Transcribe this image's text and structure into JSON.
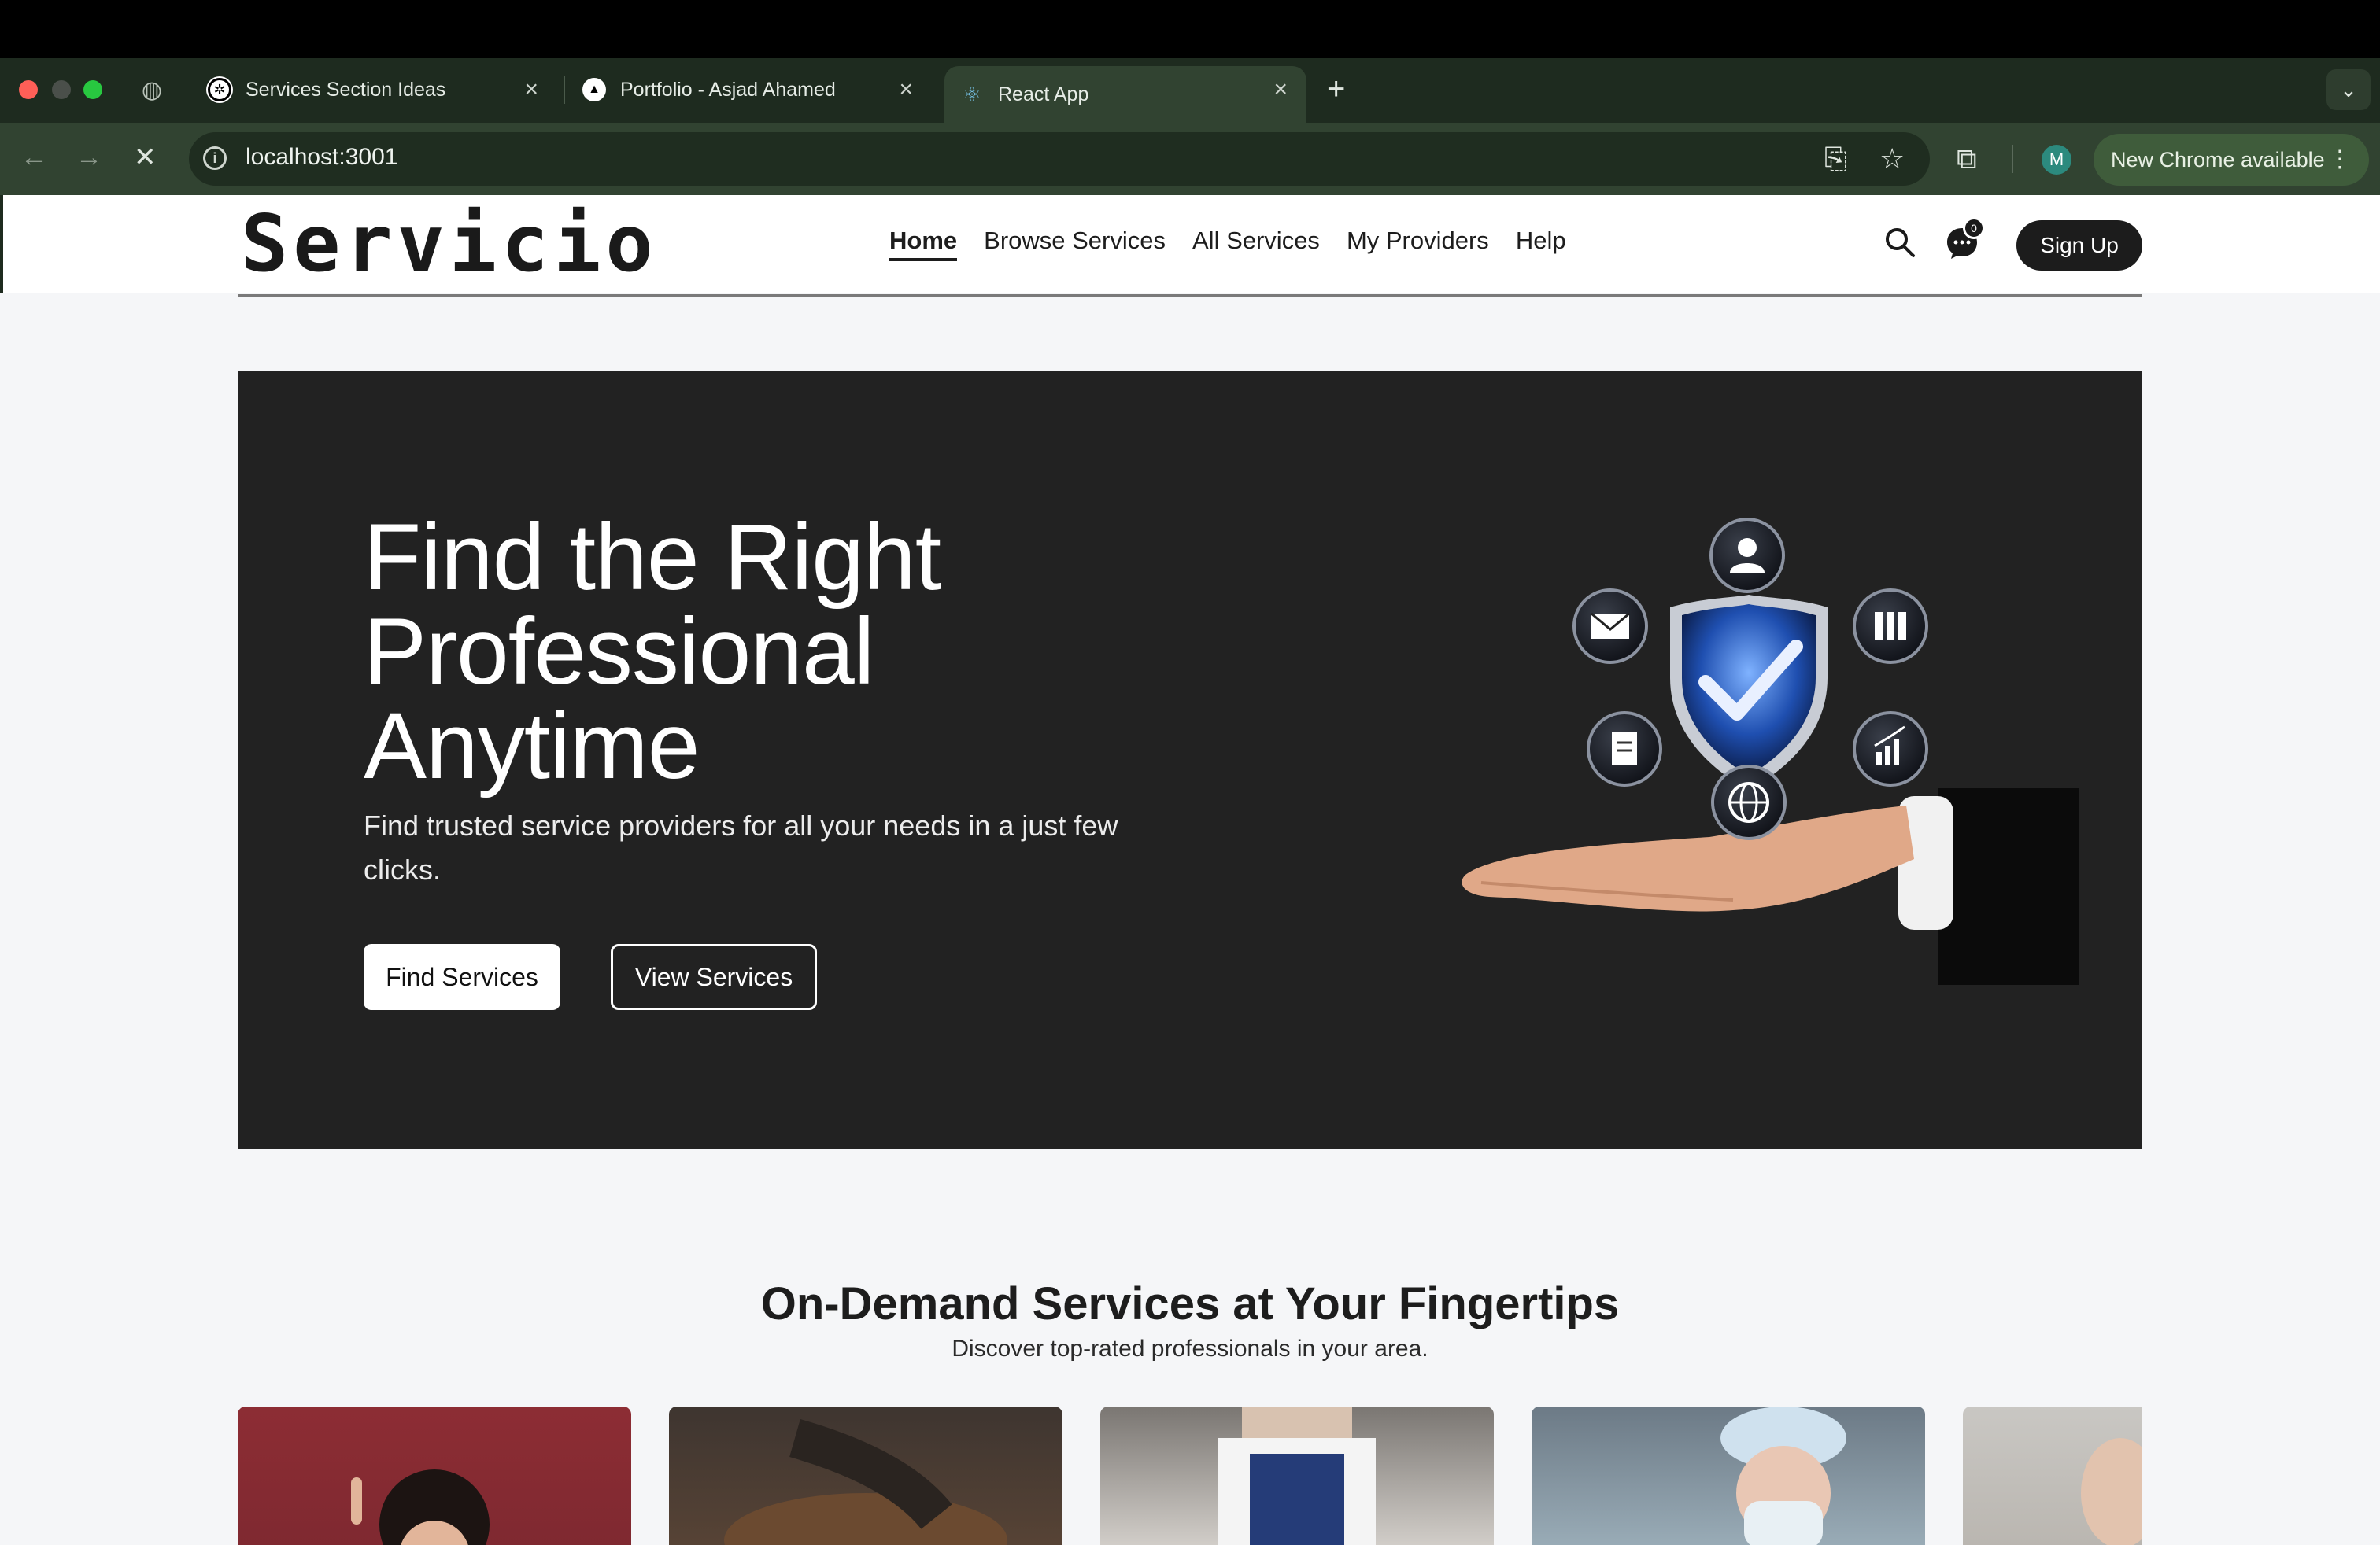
{
  "browser": {
    "tabs": [
      {
        "title": "Services Section Ideas",
        "favicon": "openai-icon"
      },
      {
        "title": "Portfolio - Asjad Ahamed",
        "favicon": "vercel-icon"
      },
      {
        "title": "React App",
        "favicon": "react-icon",
        "active": true
      }
    ],
    "close_glyph": "×",
    "new_tab_glyph": "+",
    "url": "localhost:3001",
    "profile_initial": "M",
    "update_label": "New Chrome available"
  },
  "site": {
    "logo": "Servicio",
    "nav": [
      {
        "label": "Home",
        "active": true
      },
      {
        "label": "Browse Services"
      },
      {
        "label": "All Services"
      },
      {
        "label": "My Providers"
      },
      {
        "label": "Help"
      }
    ],
    "chat_badge": "0",
    "signup_label": "Sign Up"
  },
  "hero": {
    "title_lines": [
      "Find the Right",
      "Professional",
      "Anytime"
    ],
    "subtitle": "Find trusted service providers for all your needs in a just few clicks.",
    "primary_button": "Find Services",
    "secondary_button": "View Services"
  },
  "services": {
    "title": "On-Demand Services at Your Fingertips",
    "subtitle": "Discover top-rated professionals in your area."
  },
  "colors": {
    "accent_dark": "#222222",
    "chrome_green": "#314331",
    "update_pill": "#3f5c3b"
  }
}
